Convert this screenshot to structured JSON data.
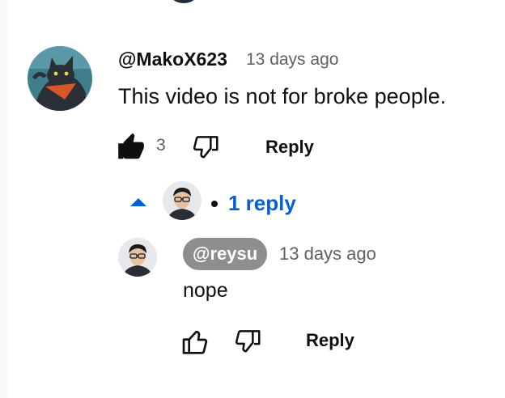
{
  "comment": {
    "author": "@MakoX623",
    "time": "13 days ago",
    "text": "This video is not for broke people.",
    "like_count": "3",
    "reply_label": "Reply",
    "avatar_icon": "cat-avatar-icon"
  },
  "replies_toggle": {
    "label": "1 reply",
    "icon": "caret-up-icon"
  },
  "reply": {
    "author": "@reysu",
    "time": "13 days ago",
    "text": "nope",
    "reply_label": "Reply",
    "avatar_icon": "person-avatar-icon"
  },
  "colors": {
    "link_blue": "#065fd4",
    "author_chip": "#8e8e8e",
    "meta_gray": "#606060"
  }
}
